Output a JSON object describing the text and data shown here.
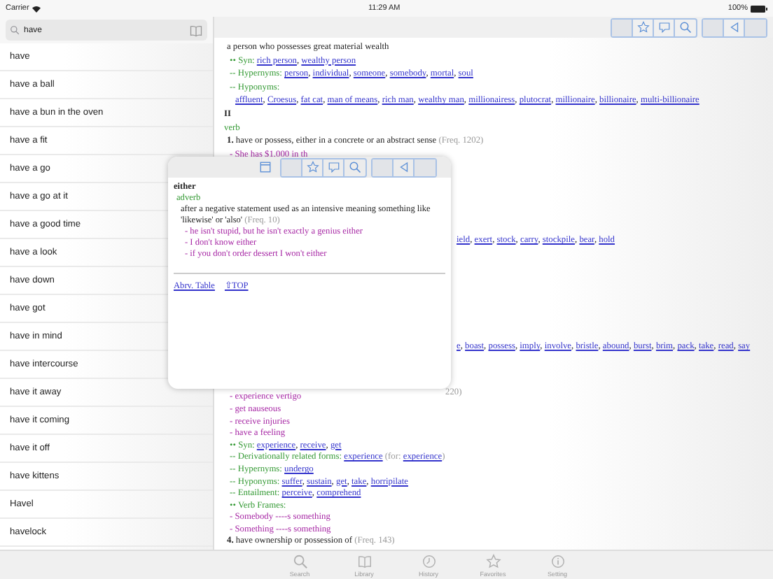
{
  "status_bar": {
    "carrier": "Carrier",
    "time": "11:29 AM",
    "battery": "100%"
  },
  "search": {
    "value": "have"
  },
  "results": [
    "have",
    "have a ball",
    "have a bun in the oven",
    "have a fit",
    "have a go",
    "have a go at it",
    "have a good time",
    "have a look",
    "have down",
    "have got",
    "have in mind",
    "have intercourse",
    "have it away",
    "have it coming",
    "have it off",
    "have kittens",
    "Havel",
    "havelock"
  ],
  "toolbar": {
    "groups": [
      [
        {
          "kind": "blank"
        },
        {
          "kind": "star"
        },
        {
          "kind": "comment"
        },
        {
          "kind": "search"
        }
      ],
      [
        {
          "kind": "blank"
        },
        {
          "kind": "back"
        },
        {
          "kind": "blank"
        }
      ]
    ]
  },
  "entry": {
    "lines_above": [
      {
        "kind": "definition",
        "parts": [
          {
            "kind": "plain",
            "text": "a person who possesses great material wealth"
          }
        ]
      },
      {
        "kind": "relation",
        "parts": [
          {
            "kind": "label",
            "text": "•• Syn: "
          },
          {
            "kind": "links",
            "items": [
              "rich person",
              "wealthy person"
            ],
            "sep": ", "
          }
        ]
      },
      {
        "kind": "relation",
        "parts": [
          {
            "kind": "label",
            "text": "-- Hypernyms: "
          },
          {
            "kind": "links",
            "items": [
              "person",
              "individual",
              "someone",
              "somebody",
              "mortal",
              "soul"
            ],
            "sep": ", "
          }
        ]
      },
      {
        "kind": "relation",
        "parts": [
          {
            "kind": "label",
            "text": "-- Hyponyms:"
          }
        ]
      },
      {
        "kind": "links",
        "parts": [
          {
            "kind": "links",
            "items": [
              "affluent",
              "Croesus",
              "fat cat",
              "man of means",
              "rich man",
              "wealthy man",
              "millionairess",
              "plutocrat",
              "millionaire",
              "billionaire",
              "multi-billionaire"
            ],
            "sep": ", "
          }
        ]
      },
      {
        "kind": "heading",
        "parts": [
          {
            "kind": "plain",
            "text": "II"
          }
        ]
      },
      {
        "kind": "pos",
        "parts": [
          {
            "kind": "plain",
            "text": "verb"
          }
        ]
      },
      {
        "kind": "sense",
        "parts": [
          {
            "kind": "number",
            "text": "1. "
          },
          {
            "kind": "plain",
            "text": "have or possess, either in a concrete or an abstract sense "
          },
          {
            "kind": "freq",
            "text": "(Freq. 1202)"
          }
        ]
      },
      {
        "kind": "example",
        "parts": [
          {
            "kind": "plain",
            "text": "- She has $1,000 in th"
          }
        ]
      }
    ],
    "beside_popup": [
      {
        "kind": "links",
        "parts": [
          {
            "kind": "links",
            "items": [
              "ield",
              "exert",
              "stock",
              "carry",
              "stockpile",
              "bear",
              "hold"
            ],
            "sep": ", "
          }
        ]
      },
      {
        "kind": "links",
        "parts": [
          {
            "kind": "links",
            "items": [
              "e",
              "boast",
              "possess",
              "imply",
              "involve",
              "bristle",
              "abound",
              "burst",
              "brim",
              "pack",
              "take",
              "read",
              "say"
            ],
            "sep": ", "
          }
        ]
      },
      {
        "kind": "links",
        "parts": [
          {
            "kind": "freq",
            "text": "220)"
          }
        ]
      }
    ],
    "lines_below": [
      {
        "kind": "example",
        "parts": [
          {
            "kind": "plain",
            "text": "- experience vertigo"
          }
        ]
      },
      {
        "kind": "example",
        "parts": [
          {
            "kind": "plain",
            "text": "- get nauseous"
          }
        ]
      },
      {
        "kind": "example",
        "parts": [
          {
            "kind": "plain",
            "text": "- receive injuries"
          }
        ]
      },
      {
        "kind": "example",
        "parts": [
          {
            "kind": "plain",
            "text": "- have a feeling"
          }
        ]
      },
      {
        "kind": "relation",
        "parts": [
          {
            "kind": "label",
            "text": "•• Syn: "
          },
          {
            "kind": "links",
            "items": [
              "experience",
              "receive",
              "get"
            ],
            "sep": ", "
          }
        ]
      },
      {
        "kind": "relation",
        "parts": [
          {
            "kind": "label",
            "text": "-- Derivationally related forms: "
          },
          {
            "kind": "links",
            "items": [
              "experience"
            ]
          },
          {
            "kind": "freq",
            "text": " (for: "
          },
          {
            "kind": "links",
            "items": [
              "experience"
            ]
          },
          {
            "kind": "freq",
            "text": ")"
          }
        ]
      },
      {
        "kind": "relation",
        "parts": [
          {
            "kind": "label",
            "text": "-- Hypernyms: "
          },
          {
            "kind": "links",
            "items": [
              "undergo"
            ]
          }
        ]
      },
      {
        "kind": "relation",
        "parts": [
          {
            "kind": "label",
            "text": "-- Hyponyms: "
          },
          {
            "kind": "links",
            "items": [
              "suffer",
              "sustain",
              "get",
              "take",
              "horripilate"
            ],
            "sep": ", "
          }
        ]
      },
      {
        "kind": "relation",
        "parts": [
          {
            "kind": "label",
            "text": "-- Entailment: "
          },
          {
            "kind": "links",
            "items": [
              "perceive",
              "comprehend"
            ],
            "sep": ", "
          }
        ]
      },
      {
        "kind": "relation",
        "parts": [
          {
            "kind": "label",
            "text": "•• Verb Frames:"
          }
        ]
      },
      {
        "kind": "example",
        "parts": [
          {
            "kind": "plain",
            "text": "- Somebody ----s something"
          }
        ]
      },
      {
        "kind": "example",
        "parts": [
          {
            "kind": "plain",
            "text": "- Something ----s something"
          }
        ]
      },
      {
        "kind": "sense",
        "parts": [
          {
            "kind": "number",
            "text": "4. "
          },
          {
            "kind": "plain",
            "text": "have ownership or possession of "
          },
          {
            "kind": "freq",
            "text": "(Freq. 143)"
          }
        ]
      }
    ]
  },
  "popup": {
    "toolbar": {
      "groups": [
        [
          {
            "kind": "window"
          }
        ],
        [
          {
            "kind": "blank"
          },
          {
            "kind": "star"
          },
          {
            "kind": "comment"
          },
          {
            "kind": "search"
          }
        ],
        [
          {
            "kind": "blank"
          },
          {
            "kind": "back"
          },
          {
            "kind": "blank"
          }
        ]
      ]
    },
    "word": "either",
    "pos": "adverb",
    "definition": "after a negative statement used as an intensive meaning something like 'likewise' or 'also'",
    "freq": "(Freq. 10)",
    "examples": [
      "- he isn't stupid, but he isn't exactly a genius either",
      "- I don't know either",
      "- if you don't order dessert I won't either"
    ],
    "links": [
      "Abrv. Table",
      "⇧TOP"
    ]
  },
  "tab_bar": [
    {
      "label": "Search",
      "kind": "search"
    },
    {
      "label": "Library",
      "kind": "book"
    },
    {
      "label": "History",
      "kind": "clock"
    },
    {
      "label": "Favorites",
      "kind": "star"
    },
    {
      "label": "Setting",
      "kind": "info"
    }
  ]
}
